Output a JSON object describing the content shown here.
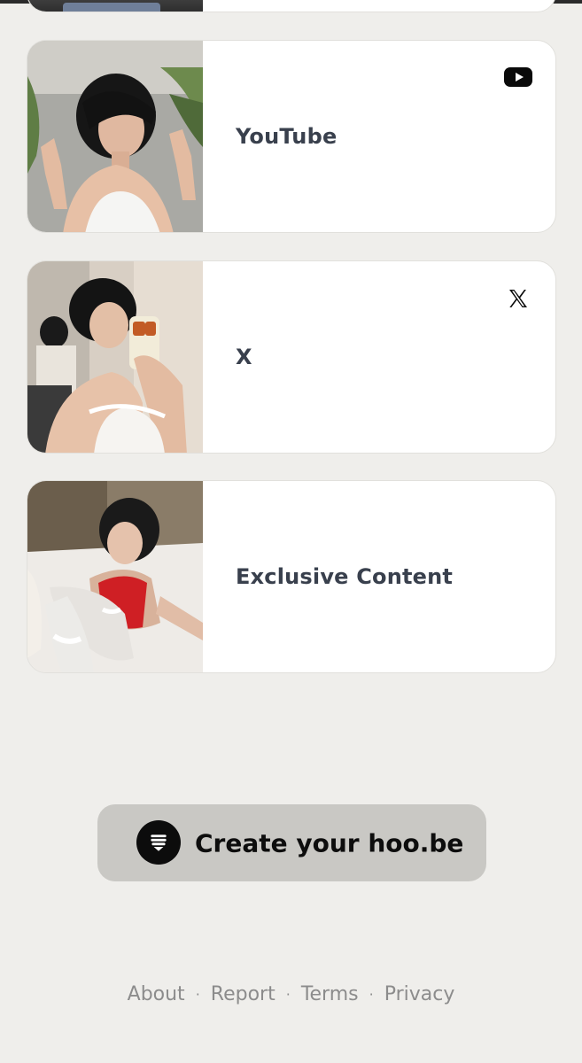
{
  "cards": [
    {
      "label": "YouTube",
      "icon": "youtube-icon"
    },
    {
      "label": "X",
      "icon": "x-icon"
    },
    {
      "label": "Exclusive Content",
      "icon": ""
    }
  ],
  "cta": {
    "label": "Create your hoo.be",
    "icon": "hoobe-logo-icon"
  },
  "footer": {
    "links": [
      "About",
      "Report",
      "Terms",
      "Privacy"
    ],
    "separator": "·"
  },
  "colors": {
    "background": "#efeeeb",
    "card": "#ffffff",
    "card_text": "#39404d",
    "cta_background": "#c9c8c4",
    "footer_text": "#8c8c8c"
  }
}
